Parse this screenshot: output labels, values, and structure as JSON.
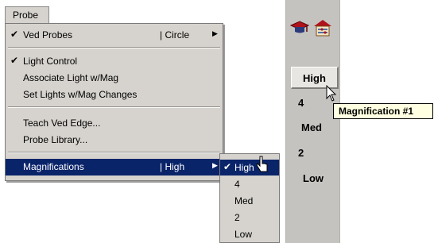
{
  "menubar": {
    "probe_label": "Probe"
  },
  "menu": {
    "items": [
      {
        "label": "Ved Probes",
        "checked": true,
        "shortcut": "| Circle",
        "arrow": "▶"
      },
      {
        "label": "Light Control",
        "checked": true
      },
      {
        "label": "Associate Light w/Mag"
      },
      {
        "label": "Set Lights w/Mag Changes"
      },
      {
        "label": "Teach Ved Edge..."
      },
      {
        "label": "Probe Library..."
      },
      {
        "label": "Magnifications",
        "shortcut": "| High",
        "arrow": "▶",
        "highlighted": true
      }
    ],
    "check_glyph": "✔"
  },
  "submenu": {
    "items": [
      {
        "label": "High",
        "checked": true,
        "highlighted": true
      },
      {
        "label": "4"
      },
      {
        "label": "Med"
      },
      {
        "label": "2"
      },
      {
        "label": "Low"
      }
    ]
  },
  "panel": {
    "icons": [
      "graduation-cap-icon",
      "light-settings-icon"
    ],
    "button_label": "High",
    "labels": [
      "4",
      "Med",
      "2",
      "Low"
    ],
    "tooltip": "Magnification #1"
  },
  "colors": {
    "menu_bg": "#d6d3ce",
    "highlight": "#0a246a",
    "panel_bg": "#c5c3c0",
    "tooltip_bg": "#ffffe1"
  }
}
